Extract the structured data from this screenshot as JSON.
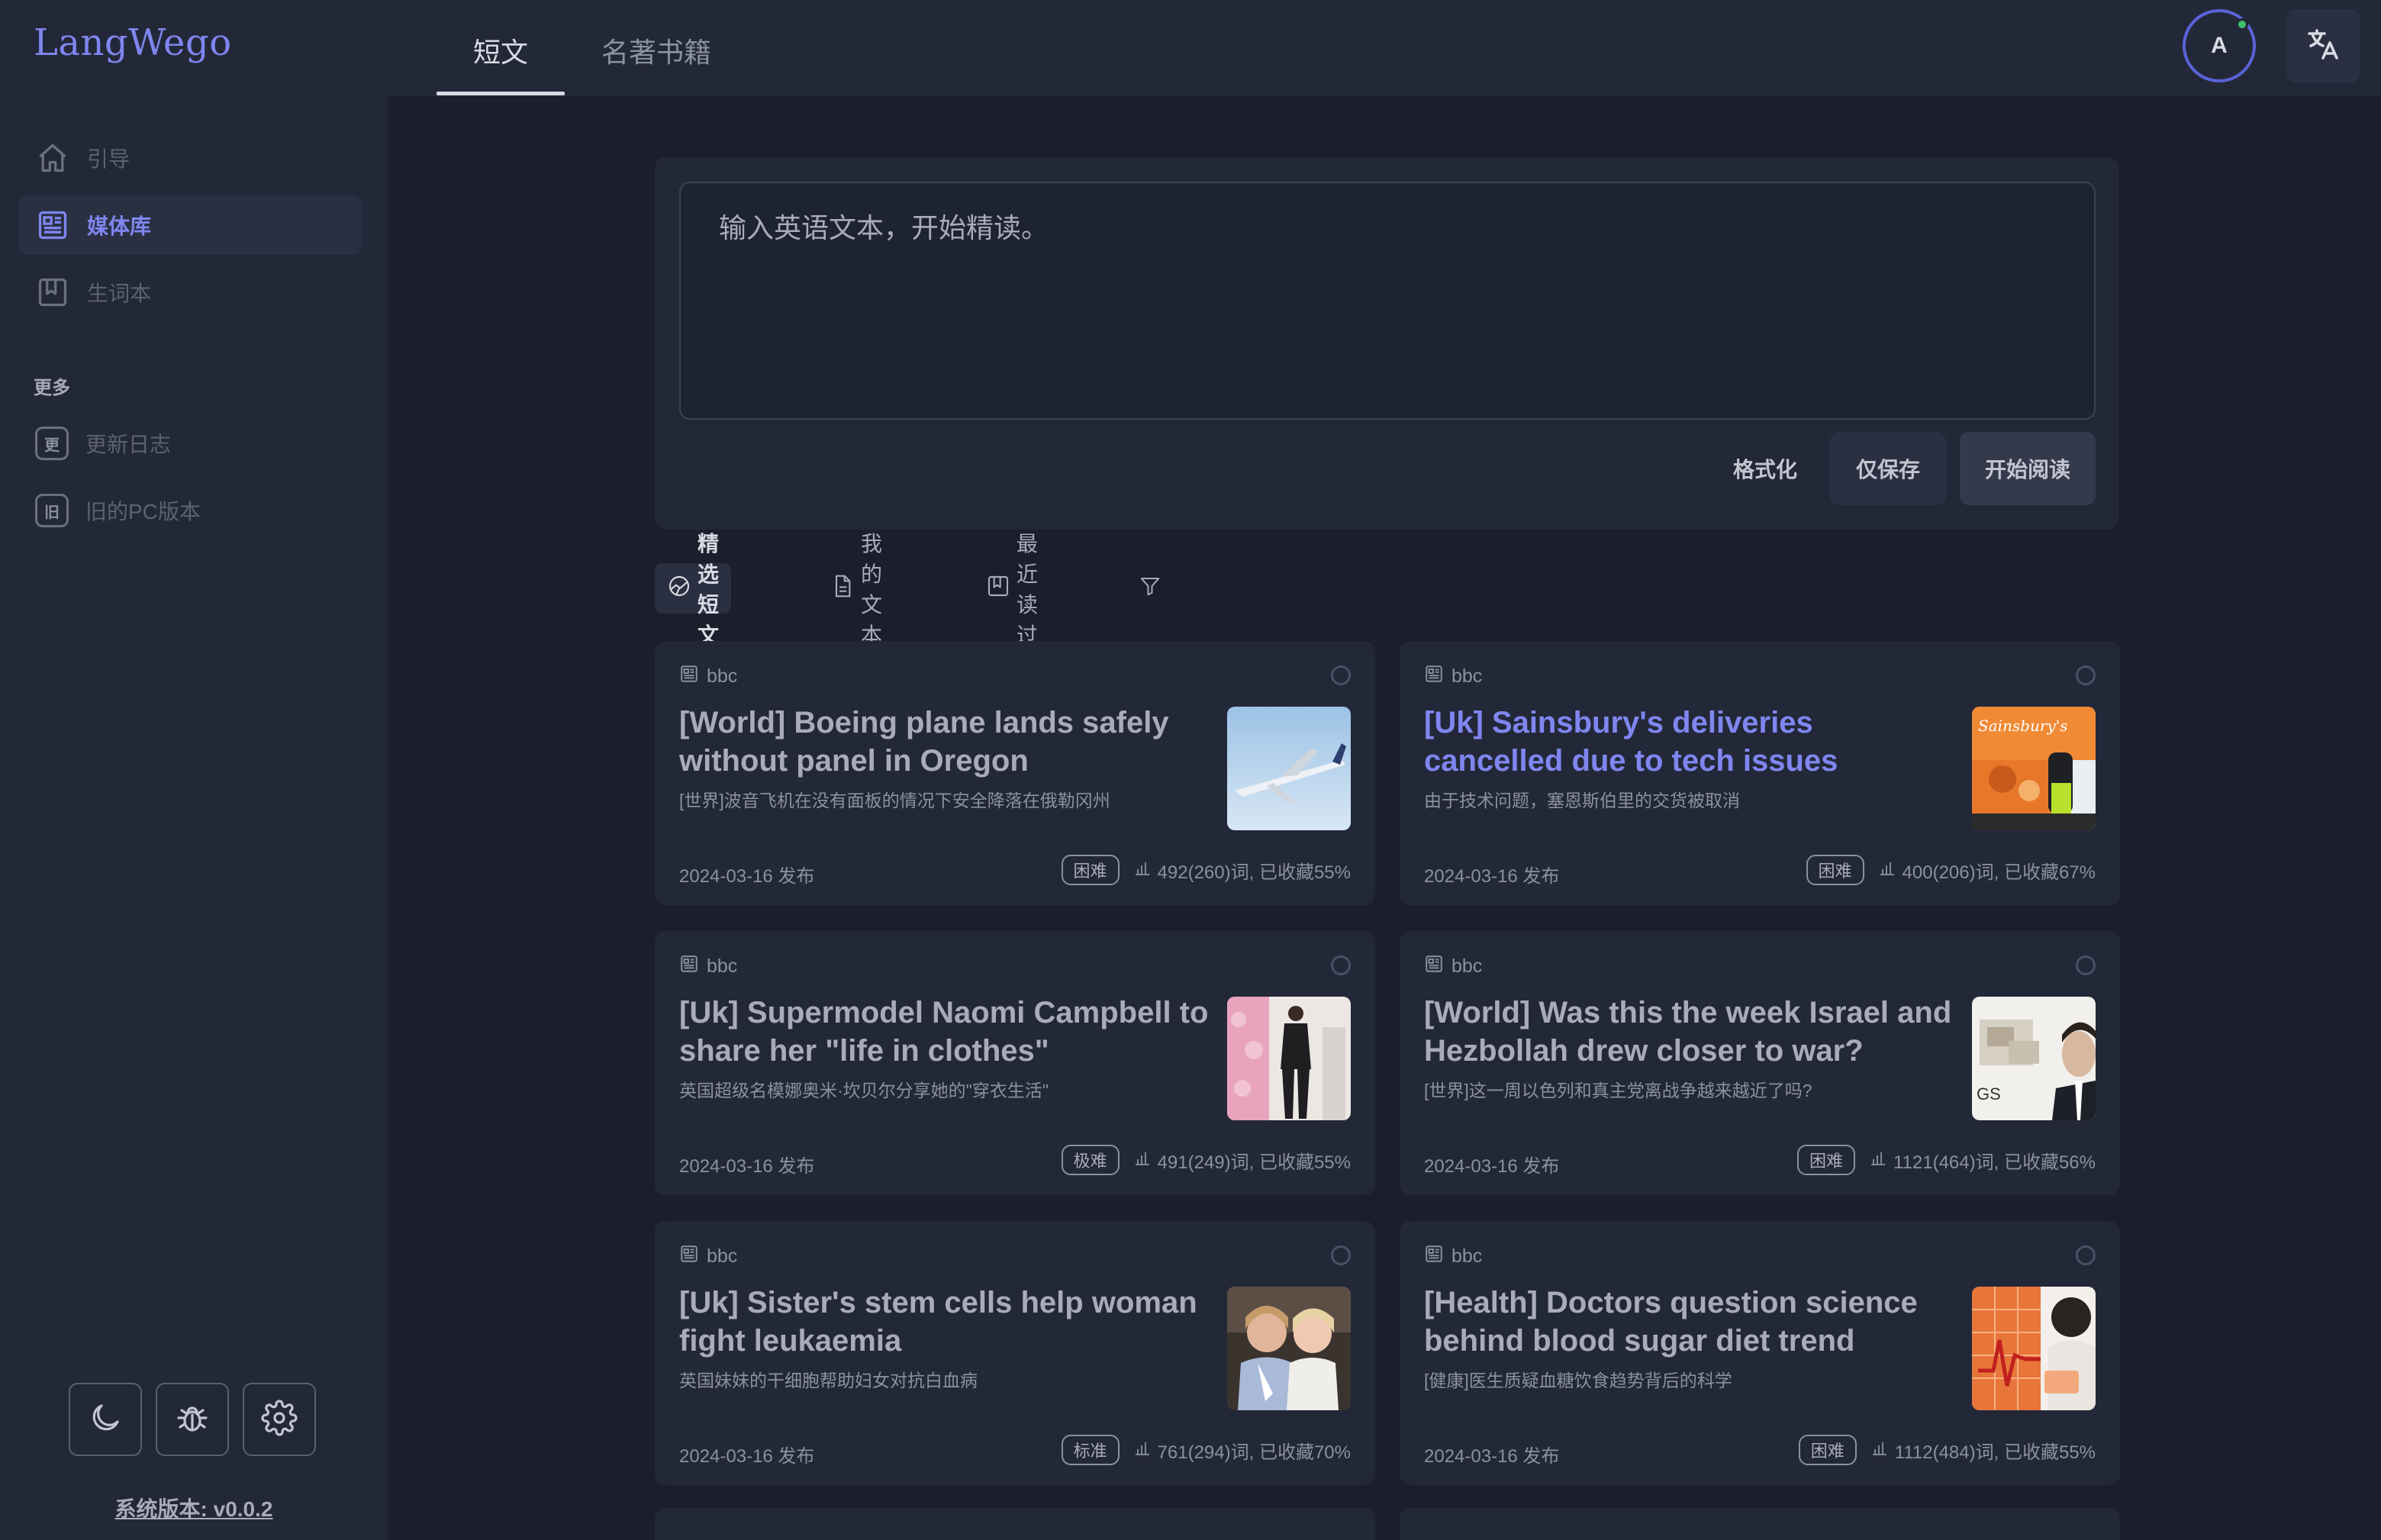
{
  "app": {
    "title": "LangWego"
  },
  "sidebar": {
    "items": [
      {
        "label": "引导",
        "icon": "home-icon"
      },
      {
        "label": "媒体库",
        "icon": "media-library-icon",
        "active": true
      },
      {
        "label": "生词本",
        "icon": "wordbook-icon"
      }
    ],
    "section_title": "更多",
    "more_items": [
      {
        "label": "更新日志",
        "icon_text": "更",
        "icon": "changelog-icon"
      },
      {
        "label": "旧的PC版本",
        "icon_text": "旧",
        "icon": "old-version-icon"
      }
    ],
    "bottom_buttons": [
      "moon-icon",
      "bug-icon",
      "gear-icon"
    ],
    "version": "系统版本: v0.0.2"
  },
  "topbar": {
    "tabs": [
      {
        "label": "短文",
        "active": true
      },
      {
        "label": "名著书籍",
        "active": false
      }
    ],
    "avatar_letter": "A",
    "accent_color": "#7f86f0",
    "online_color": "#3fbf6a"
  },
  "editor": {
    "placeholder": "输入英语文本，开始精读。",
    "format_label": "格式化",
    "save_label": "仅保存",
    "start_label": "开始阅读"
  },
  "filters": [
    {
      "label": "精选短文",
      "icon": "featured-icon",
      "active": true
    },
    {
      "label": "我的文本",
      "icon": "document-icon",
      "active": false
    },
    {
      "label": "最近读过",
      "icon": "book-icon",
      "active": false
    }
  ],
  "articles": [
    {
      "source": "bbc",
      "title": "[World] Boeing plane lands safely without panel in Oregon",
      "title_zh": "[世界]波音飞机在没有面板的情况下安全降落在俄勒冈州",
      "date": "2024-03-16 发布",
      "difficulty": "困难",
      "stats": "492(260)词, 已收藏55%",
      "thumb": "airplane-thumbnail",
      "highlight": false
    },
    {
      "source": "bbc",
      "title": "[Uk] Sainsbury's deliveries cancelled due to tech issues",
      "title_zh": "由于技术问题，塞恩斯伯里的交货被取消",
      "date": "2024-03-16 发布",
      "difficulty": "困难",
      "stats": "400(206)词, 已收藏67%",
      "thumb": "sainsburys-truck-thumbnail",
      "highlight": true
    },
    {
      "source": "bbc",
      "title": "[Uk] Supermodel Naomi Campbell to share her \"life in clothes\"",
      "title_zh": "英国超级名模娜奥米·坎贝尔分享她的\"穿衣生活\"",
      "date": "2024-03-16 发布",
      "difficulty": "极难",
      "stats": "491(249)词, 已收藏55%",
      "thumb": "fashion-thumbnail",
      "highlight": false
    },
    {
      "source": "bbc",
      "title": "[World] Was this the week Israel and Hezbollah drew closer to war?",
      "title_zh": "[世界]这一周以色列和真主党离战争越来越近了吗?",
      "date": "2024-03-16 发布",
      "difficulty": "困难",
      "stats": "1121(464)词, 已收藏56%",
      "thumb": "news-portrait-thumbnail",
      "thumb_text": "GS",
      "highlight": false
    },
    {
      "source": "bbc",
      "title": "[Uk] Sister's stem cells help woman fight leukaemia",
      "title_zh": "英国妹妹的干细胞帮助妇女对抗白血病",
      "date": "2024-03-16 发布",
      "difficulty": "标准",
      "stats": "761(294)词, 已收藏70%",
      "thumb": "sisters-thumbnail",
      "highlight": false
    },
    {
      "source": "bbc",
      "title": "[Health] Doctors question science behind blood sugar diet trend",
      "title_zh": "[健康]医生质疑血糖饮食趋势背后的科学",
      "date": "2024-03-16 发布",
      "difficulty": "困难",
      "stats": "1112(484)词, 已收藏55%",
      "thumb": "blood-sugar-thumbnail",
      "highlight": false
    }
  ]
}
